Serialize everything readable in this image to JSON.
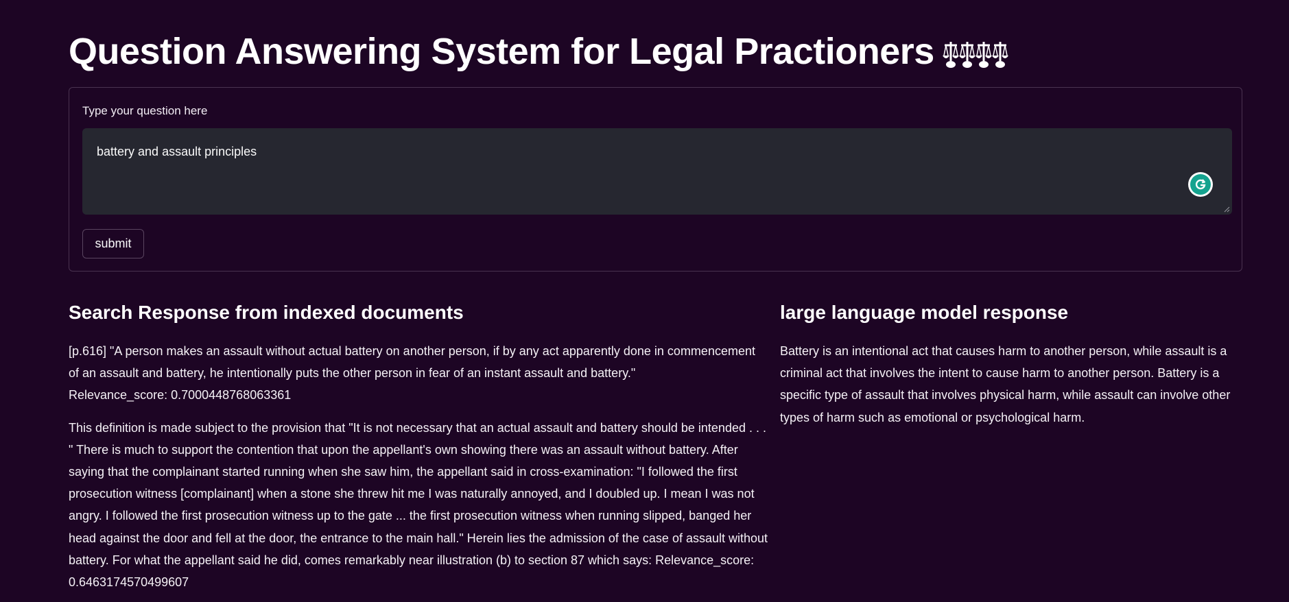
{
  "app": {
    "title": "Question Answering System for Legal Practioners",
    "title_emoji_icon": "balance-scale-icon"
  },
  "form": {
    "label": "Type your question here",
    "question_value": "battery and assault principles",
    "submit_label": "submit",
    "assist_icon": "grammarly-g-icon"
  },
  "search": {
    "heading": "Search Response from indexed documents",
    "results": [
      {
        "text": "[p.616] \"A person makes an assault without actual battery on another person, if by any act apparently done in commencement of an assault and battery, he intentionally puts the other person in fear of an instant assault and battery.\"",
        "score": "Relevance_score: 0.7000448768063361"
      },
      {
        "text": "This definition is made subject to the provision that \"It is not necessary that an actual assault and battery should be intended . . . \" There is much to support the contention that upon the appellant's own showing there was an assault without battery. After saying that the complainant started running when she saw him, the appellant said in cross-examination: \"I followed the first prosecution witness [complainant] when a stone she threw hit me I was naturally annoyed, and I doubled up. I mean I was not angry. I followed the first prosecution witness up to the gate ... the first prosecution witness when running slipped, banged her head against the door and fell at the door, the entrance to the main hall.\" Herein lies the admission of the case of assault without battery. For what the appellant said he did, comes remarkably near illustration (b) to section 87 which says:",
        "score": "Relevance_score: 0.6463174570499607"
      }
    ]
  },
  "llm": {
    "heading": "large language model response",
    "answer": "Battery is an intentional act that causes harm to another person, while assault is a criminal act that involves the intent to cause harm to another person. Battery is a specific type of assault that involves physical harm, while assault can involve other types of harm such as emotional or psychological harm."
  },
  "colors": {
    "background": "#1d0524",
    "input_background": "#262730",
    "text": "#fafafa",
    "grammarly_green": "#15a38f"
  }
}
